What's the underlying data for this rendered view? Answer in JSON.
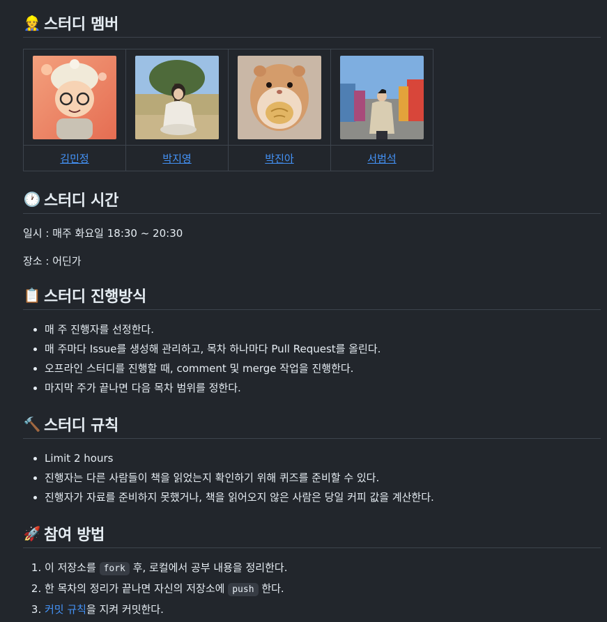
{
  "sections": {
    "members": {
      "emoji": "👷",
      "title": "스터디 멤버",
      "people": [
        {
          "name": "김민정"
        },
        {
          "name": "박지영"
        },
        {
          "name": "박진아"
        },
        {
          "name": "서범석"
        }
      ]
    },
    "time": {
      "emoji": "🕐",
      "title": "스터디 시간",
      "schedule": "일시 : 매주 화요일 18:30 ~ 20:30",
      "place": "장소 : 어딘가"
    },
    "process": {
      "emoji": "📋",
      "title": "스터디 진행방식",
      "items": [
        "매 주 진행자를 선정한다.",
        "매 주마다 Issue를 생성해 관리하고, 목차 하나마다 Pull Request를 올린다.",
        "오프라인 스터디를 진행할 때, comment 및 merge 작업을 진행한다.",
        "마지막 주가 끝나면 다음 목차 범위를 정한다."
      ]
    },
    "rules": {
      "emoji": "🔨",
      "title": "스터디 규칙",
      "items": [
        "Limit 2 hours",
        "진행자는 다른 사람들이 책을 읽었는지 확인하기 위해 퀴즈를 준비할 수 있다.",
        "진행자가 자료를 준비하지 못했거나, 책을 읽어오지 않은 사람은 당일 커피 값을 계산한다."
      ]
    },
    "join": {
      "emoji": "🚀",
      "title": "참여 방법",
      "step1_pre": "이 저장소를",
      "step1_code": "fork",
      "step1_post": "후, 로컬에서 공부 내용을 정리한다.",
      "step2_pre": "한 목차의 정리가 끝나면 자신의 저장소에",
      "step2_code": "push",
      "step2_post": "한다.",
      "step3_link": "커밋 규칙",
      "step3_post": "을 지켜 커밋한다."
    }
  }
}
